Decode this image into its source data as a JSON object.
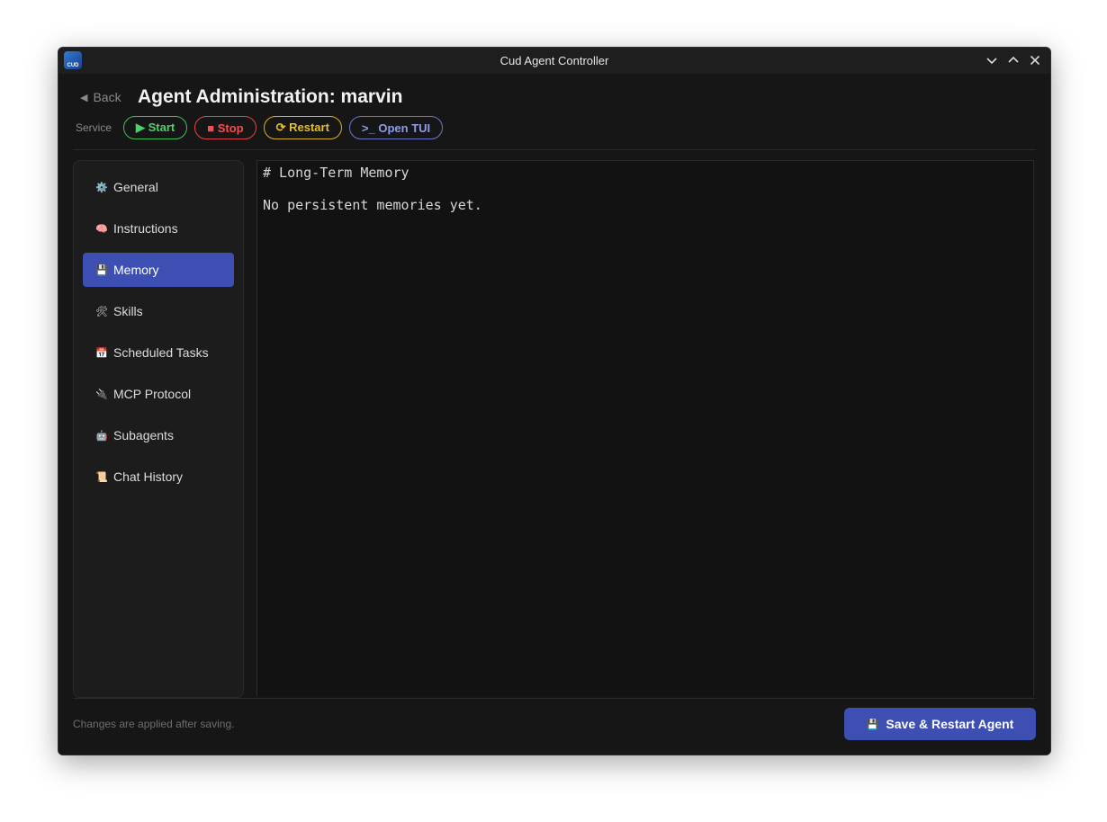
{
  "window": {
    "title": "Cud Agent Controller",
    "app_icon_text": "CUD"
  },
  "header": {
    "back_label": "Back",
    "back_arrow": "◀",
    "title": "Agent Administration: marvin"
  },
  "service": {
    "label": "Service",
    "start_label": "▶ Start",
    "stop_label": "■ Stop",
    "restart_label": "⟳ Restart",
    "tui_label": ">_ Open TUI"
  },
  "sidebar": {
    "items": [
      {
        "label": "General",
        "icon": "⚙️"
      },
      {
        "label": "Instructions",
        "icon": "🧠"
      },
      {
        "label": "Memory",
        "icon": "💾"
      },
      {
        "label": "Skills",
        "icon": "🛠"
      },
      {
        "label": "Scheduled Tasks",
        "icon": "📅"
      },
      {
        "label": "MCP Protocol",
        "icon": "🔌"
      },
      {
        "label": "Subagents",
        "icon": "🤖"
      },
      {
        "label": "Chat History",
        "icon": "📜"
      }
    ],
    "active_index": 2
  },
  "editor": {
    "lines": [
      "# Long-Term Memory",
      "",
      "No persistent memories yet."
    ]
  },
  "footer": {
    "note": "Changes are applied after saving.",
    "save_icon": "💾",
    "save_label": "Save & Restart Agent"
  },
  "colors": {
    "accent": "#3e4fb4",
    "start": "#4cd06a",
    "stop": "#ef5050",
    "restart": "#e5be2a",
    "tui": "#8e9ce8"
  }
}
